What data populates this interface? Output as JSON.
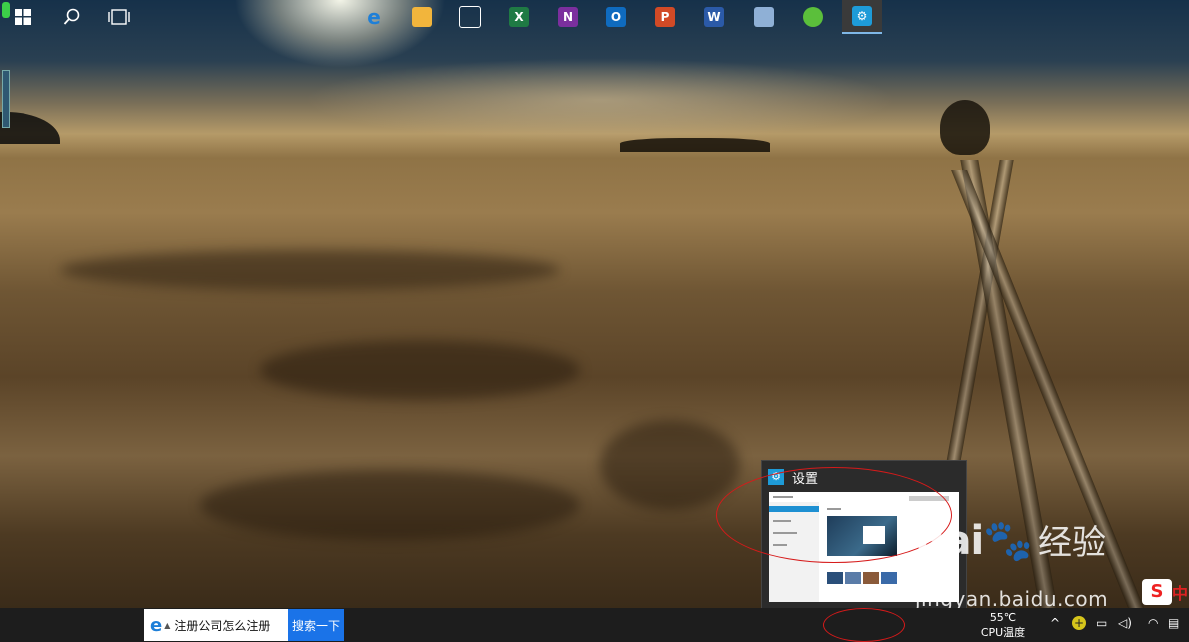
{
  "preview": {
    "title": "设置",
    "app_icon": "gear-icon",
    "thumb_title": "设置"
  },
  "watermark": {
    "brand": "Bai",
    "brand_cn": "经验",
    "url": "jingyan.baidu.com"
  },
  "ime": {
    "logo": "S",
    "lang": "中"
  },
  "taskbar": {
    "search_text": "注册公司怎么注册",
    "search_button": "搜索一下",
    "apps": [
      {
        "name": "edge-icon",
        "label": "e",
        "color": "#1e7fd8"
      },
      {
        "name": "file-explorer-icon",
        "label": "",
        "color": "#f2b53c"
      },
      {
        "name": "store-icon",
        "label": "",
        "color": "#ffffff"
      },
      {
        "name": "excel-icon",
        "label": "X",
        "color": "#1f7a44"
      },
      {
        "name": "onenote-icon",
        "label": "N",
        "color": "#7b2f9e"
      },
      {
        "name": "outlook-icon",
        "label": "O",
        "color": "#0f6bbf"
      },
      {
        "name": "powerpoint-icon",
        "label": "P",
        "color": "#d24a26"
      },
      {
        "name": "word-icon",
        "label": "W",
        "color": "#2b5aa8"
      },
      {
        "name": "paint-icon",
        "label": "",
        "color": "#8fb0d6"
      },
      {
        "name": "refresh-app-icon",
        "label": "",
        "color": "#5bbf3b"
      },
      {
        "name": "settings-icon",
        "label": "⚙",
        "color": "#1e9bd8"
      }
    ],
    "cpu_temp": "55℃",
    "cpu_label": "CPU温度"
  }
}
